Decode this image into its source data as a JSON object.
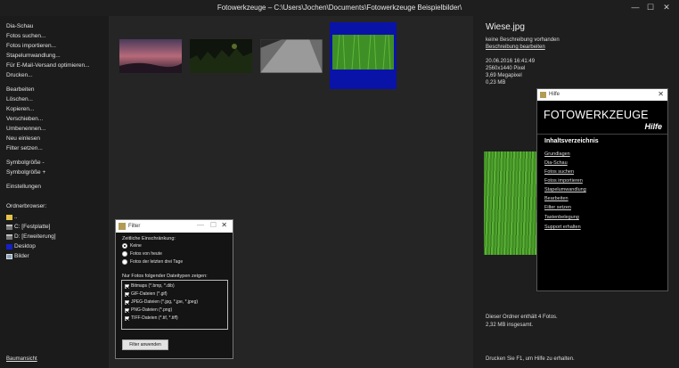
{
  "window": {
    "title": "Fotowerkzeuge – C:\\Users\\Jochen\\Documents\\Fotowerkzeuge Beispielbilder\\",
    "minimize_glyph": "—",
    "maximize_glyph": "☐",
    "close_glyph": "✕"
  },
  "sidebar": {
    "actions": [
      "Dia-Schau",
      "Fotos suchen...",
      "Fotos importieren...",
      "Stapelumwandlung...",
      "Für E-Mail-Versand optimieren...",
      "Drucken..."
    ],
    "edit": [
      "Bearbeiten",
      "Löschen...",
      "Kopieren...",
      "Verschieben...",
      "Umbenennen...",
      "Neu einlesen",
      "Filter setzen..."
    ],
    "view": [
      "Symbolgröße -",
      "Symbolgröße +"
    ],
    "settings": "Einstellungen",
    "folder_browser_label": "Ordnerbrowser:",
    "tree": [
      {
        "label": "..",
        "icon": "folder-icon"
      },
      {
        "label": "C: [Festplatte]",
        "icon": "drive-icon"
      },
      {
        "label": "D: [Erweiterung]",
        "icon": "drive-icon"
      },
      {
        "label": "Desktop",
        "icon": "desktop-icon"
      },
      {
        "label": "Bilder",
        "icon": "pictures-icon"
      }
    ],
    "footer": "Baumansicht"
  },
  "thumbnails": [
    {
      "name": "sunset-thumbnail"
    },
    {
      "name": "dark-trees-thumbnail"
    },
    {
      "name": "road-thumbnail"
    },
    {
      "name": "grass-thumbnail",
      "selected": true
    }
  ],
  "info": {
    "filename": "Wiese.jpg",
    "description": "keine Beschreibung vorhanden",
    "edit_description": "Beschreibung bearbeiten",
    "date": "20.06.2016 16:41:49",
    "resolution": "2560x1440 Pixel",
    "megapixel": "3,69 Megapixel",
    "size": "0,23 MB",
    "folder_count": "Dieser Ordner enthält 4 Fotos.",
    "folder_size": "2,32 MB insgesamt.",
    "help_hint": "Drucken Sie F1, um Hilfe zu erhalten."
  },
  "help": {
    "window_title": "Hilfe",
    "close_glyph": "✕",
    "heading": "FOTOWERKZEUGE",
    "subheading": "Hilfe",
    "toc_title": "Inhaltsverzeichnis",
    "links": [
      "Grundlagen",
      "Dia-Schau",
      "Fotos suchen",
      "Fotos importieren",
      "Stapelumwandlung",
      "Bearbeiten",
      "Filter setzen",
      "Tastenbelegung",
      "Support erhalten"
    ]
  },
  "filter": {
    "window_title": "Filter",
    "min_glyph": "—",
    "max_glyph": "☐",
    "close_glyph": "✕",
    "time_label": "Zeitliche Einschränkung:",
    "radios": [
      {
        "label": "Keine",
        "checked": true
      },
      {
        "label": "Fotos von heute",
        "checked": false
      },
      {
        "label": "Fotos der letzten drei Tage",
        "checked": false
      }
    ],
    "types_label": "Nur Fotos folgender Dateitypen zeigen:",
    "types": [
      "Bitmaps (*.bmp, *.dib)",
      "GIF-Dateien (*.gif)",
      "JPEG-Dateien (*.jpg, *.jpe, *.jpeg)",
      "PNG-Dateien (*.png)",
      "TIFF-Dateien (*.tif, *.tiff)"
    ],
    "apply_label": "Filter anwenden"
  }
}
